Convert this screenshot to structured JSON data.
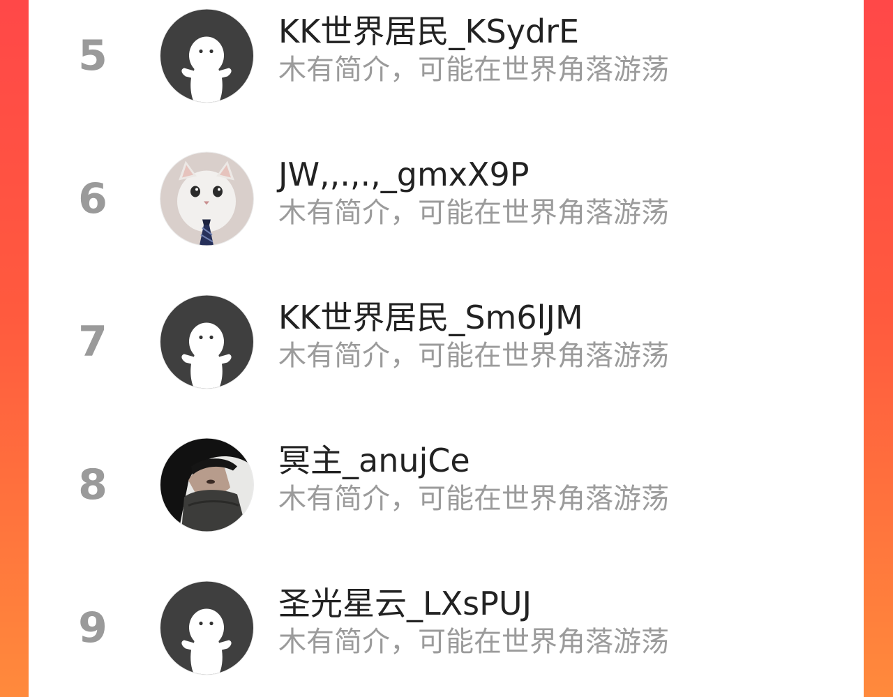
{
  "colors": {
    "background_gradient_top": "#ff4848",
    "background_gradient_bottom": "#ff8a3c",
    "card": "#ffffff",
    "rank_text": "#9a9a9a",
    "name_text": "#222222",
    "bio_text": "#9b9b9b"
  },
  "ranking": [
    {
      "rank": "5",
      "name": "KK世界居民_KSydrE",
      "bio": "木有简介，可能在世界角落游荡",
      "avatar_icon": "default-ghost-avatar-icon"
    },
    {
      "rank": "6",
      "name": "JW,,.,.,_gmxX9P",
      "bio": "木有简介，可能在世界角落游荡",
      "avatar_icon": "cat-with-tie-avatar-icon"
    },
    {
      "rank": "7",
      "name": "KK世界居民_Sm6lJM",
      "bio": "木有简介，可能在世界角落游荡",
      "avatar_icon": "default-ghost-avatar-icon"
    },
    {
      "rank": "8",
      "name": "冥主_anujCe",
      "bio": "木有简介，可能在世界角落游荡",
      "avatar_icon": "person-photo-avatar-icon"
    },
    {
      "rank": "9",
      "name": "圣光星云_LXsPUJ",
      "bio": "木有简介，可能在世界角落游荡",
      "avatar_icon": "default-ghost-avatar-icon"
    }
  ]
}
